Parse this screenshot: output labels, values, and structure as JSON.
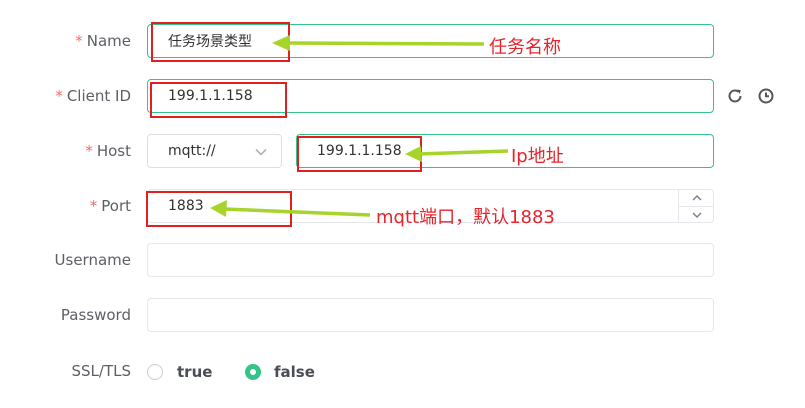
{
  "form": {
    "name": {
      "label": "Name",
      "required_mark": "*",
      "value": "任务场景类型"
    },
    "client_id": {
      "label": "Client ID",
      "required_mark": "*",
      "value": "199.1.1.158"
    },
    "host": {
      "label": "Host",
      "required_mark": "*",
      "protocol": "mqtt://",
      "value": "199.1.1.158"
    },
    "port": {
      "label": "Port",
      "required_mark": "*",
      "value": "1883"
    },
    "username": {
      "label": "Username",
      "value": ""
    },
    "password": {
      "label": "Password",
      "value": ""
    },
    "ssl_tls": {
      "label": "SSL/TLS",
      "options": [
        "true",
        "false"
      ],
      "selected": "false"
    }
  },
  "annotations": {
    "name_note": "任务名称",
    "host_note": "Ip地址",
    "port_note": "mqtt端口，默认1883"
  },
  "icons": {
    "refresh": "refresh-icon",
    "clock": "clock-icon",
    "chevron": "chevron-down-icon"
  },
  "colors": {
    "accent": "#34c388",
    "annotation_red": "#e8232b",
    "arrow_green": "#a6d42a"
  }
}
